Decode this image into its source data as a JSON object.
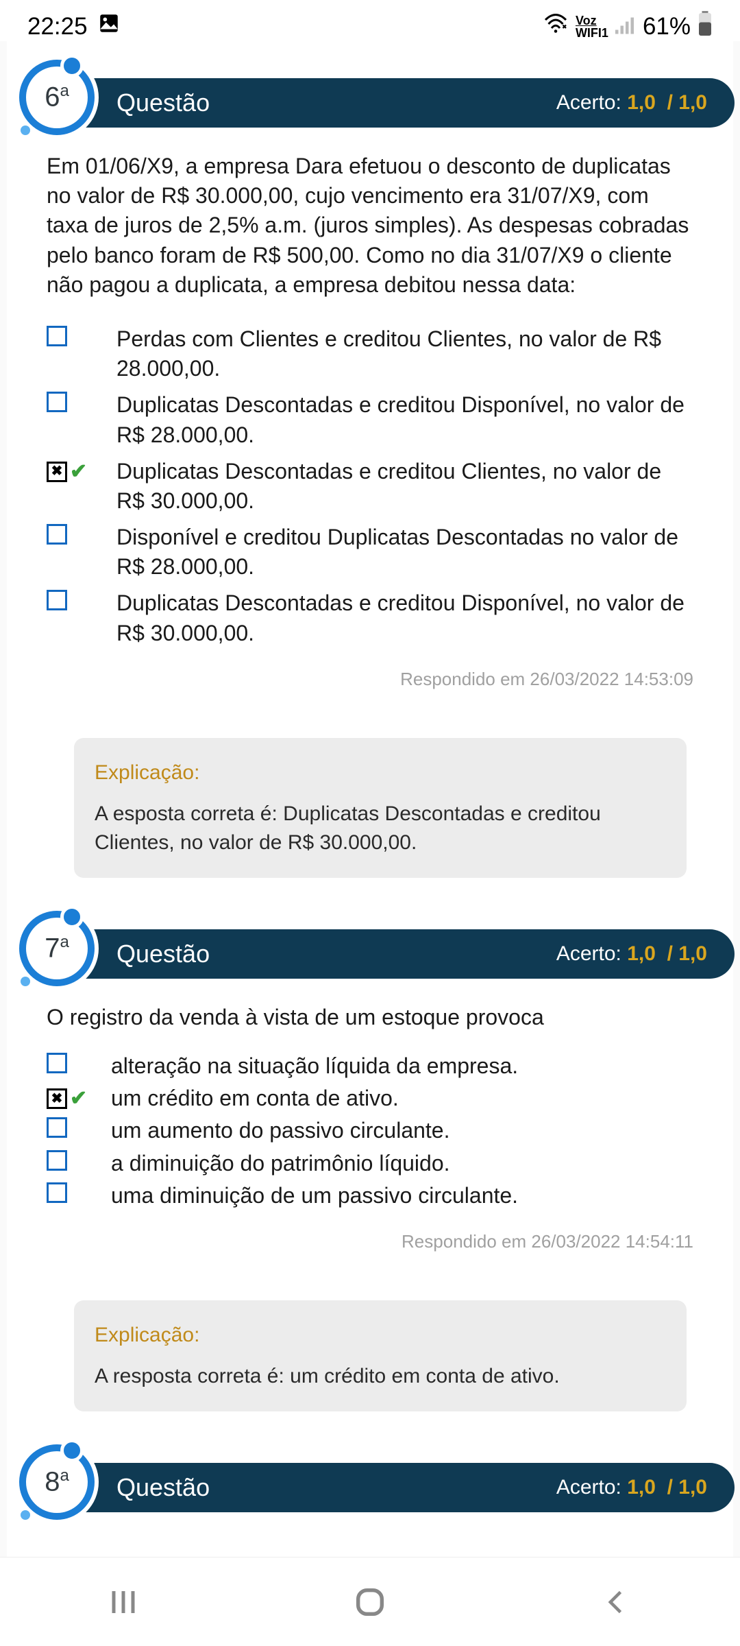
{
  "status": {
    "time": "22:25",
    "battery": "61%",
    "voz": "Voz",
    "wifi_line": "WIFI1"
  },
  "questions": [
    {
      "number": "6",
      "ord": "a",
      "title": "Questão",
      "score_label": "Acerto:",
      "score_earned": "1,0",
      "score_sep": "/",
      "score_total": "1,0",
      "prompt": "Em 01/06/X9, a empresa Dara efetuou o desconto de duplicatas no valor de R$ 30.000,00, cujo vencimento era 31/07/X9, com taxa de juros de 2,5% a.m. (juros simples). As despesas cobradas pelo banco foram de R$ 500,00. Como no dia 31/07/X9 o cliente não pagou a duplicata, a empresa debitou nessa data:",
      "options": [
        {
          "text": "Perdas com Clientes e creditou Clientes, no valor de R$ 28.000,00.",
          "selected": false,
          "correct": false
        },
        {
          "text": "Duplicatas Descontadas e creditou Disponível, no valor de R$ 28.000,00.",
          "selected": false,
          "correct": false
        },
        {
          "text": "Duplicatas Descontadas e creditou Clientes, no valor de R$ 30.000,00.",
          "selected": true,
          "correct": true
        },
        {
          "text": "Disponível e creditou Duplicatas Descontadas no valor de R$ 28.000,00.",
          "selected": false,
          "correct": false
        },
        {
          "text": "Duplicatas Descontadas e creditou Disponível, no valor de R$ 30.000,00.",
          "selected": false,
          "correct": false
        }
      ],
      "answered": "Respondido em 26/03/2022 14:53:09",
      "explain_title": "Explicação:",
      "explain_body": "A esposta correta é: Duplicatas Descontadas e creditou Clientes, no valor de R$ 30.000,00."
    },
    {
      "number": "7",
      "ord": "a",
      "title": "Questão",
      "score_label": "Acerto:",
      "score_earned": "1,0",
      "score_sep": "/",
      "score_total": "1,0",
      "prompt": "O registro da venda à vista de um estoque provoca",
      "options": [
        {
          "text": "alteração na situação líquida da empresa.",
          "selected": false,
          "correct": false
        },
        {
          "text": "um crédito em conta de ativo.",
          "selected": true,
          "correct": true
        },
        {
          "text": "um aumento do passivo circulante.",
          "selected": false,
          "correct": false
        },
        {
          "text": "a diminuição do patrimônio líquido.",
          "selected": false,
          "correct": false
        },
        {
          "text": "uma diminuição de um passivo circulante.",
          "selected": false,
          "correct": false
        }
      ],
      "answered": "Respondido em 26/03/2022 14:54:11",
      "explain_title": "Explicação:",
      "explain_body": "A resposta correta é: um crédito em conta de ativo."
    },
    {
      "number": "8",
      "ord": "a",
      "title": "Questão",
      "score_label": "Acerto:",
      "score_earned": "1,0",
      "score_sep": "/",
      "score_total": "1,0"
    }
  ]
}
